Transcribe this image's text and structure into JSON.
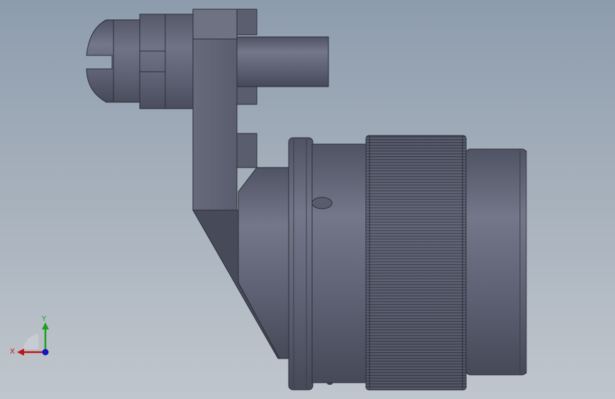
{
  "viewport": {
    "background_top": "#8d9cad",
    "background_bottom": "#c0c6cd",
    "model_color": "#5f6270"
  },
  "triad": {
    "x_label": "X",
    "y_label": "Y",
    "x_color": "#c01515",
    "y_color": "#1da01d",
    "z_color": "#1515c0"
  }
}
